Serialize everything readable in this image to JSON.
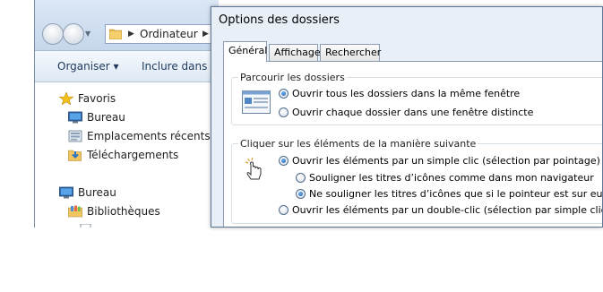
{
  "explorer": {
    "address": {
      "segment": "Ordinateur"
    },
    "toolbar": {
      "organize": "Organiser ▾",
      "include": "Inclure dans la"
    },
    "tree": [
      {
        "label": "Favoris",
        "icon": "star-icon"
      },
      {
        "label": "Bureau",
        "icon": "desktop-icon"
      },
      {
        "label": "Emplacements récents",
        "icon": "recent-places-icon"
      },
      {
        "label": "Téléchargements",
        "icon": "downloads-folder-icon"
      },
      {
        "label": "Bureau",
        "icon": "desktop-icon"
      },
      {
        "label": "Bibliothèques",
        "icon": "libraries-icon"
      }
    ]
  },
  "dialog": {
    "title": "Options des dossiers",
    "tabs": [
      "Général",
      "Affichage",
      "Rechercher"
    ],
    "active_tab": "Général",
    "browse": {
      "legend": "Parcourir les dossiers",
      "options": [
        {
          "label": "Ouvrir tous les dossiers dans la même fenêtre",
          "checked": true
        },
        {
          "label": "Ouvrir chaque dossier dans une fenêtre distincte",
          "checked": false
        }
      ]
    },
    "click": {
      "legend": "Cliquer sur les éléments de la manière suivante",
      "single": {
        "label": "Ouvrir les éléments par un simple clic (sélection par pointage)",
        "checked": true
      },
      "underline_browser": {
        "label": "Souligner les titres d’icônes comme dans mon navigateur",
        "checked": false
      },
      "underline_hover": {
        "label": "Ne souligner les titres d’icônes que si le pointeur est sur eux",
        "checked": true
      },
      "double": {
        "label": "Ouvrir les éléments par un double-clic (sélection par simple clic)",
        "checked": false
      }
    }
  },
  "colors": {
    "dialog_bg": "#e9eff7",
    "explorer_nav": "#c6d7ec",
    "toolbar_text": "#1e395b",
    "radio_dot": "#1c5ea9"
  }
}
